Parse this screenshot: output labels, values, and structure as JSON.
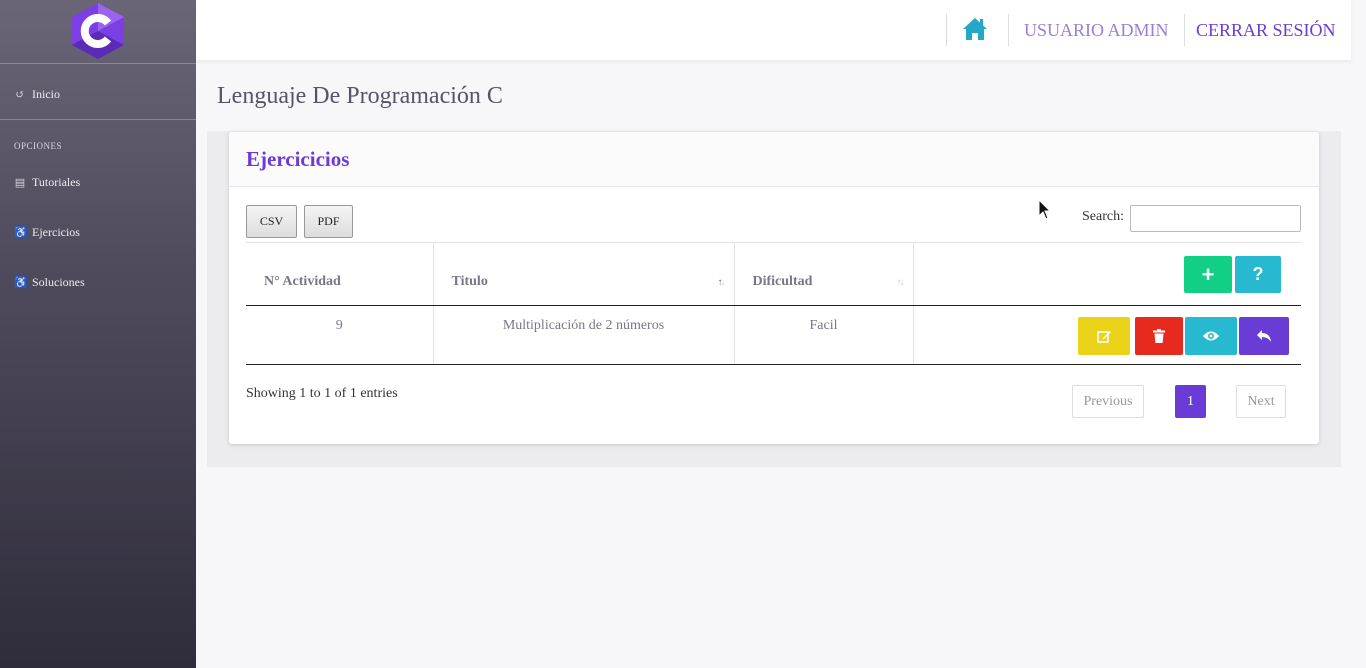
{
  "sidebar": {
    "items": [
      {
        "label": "Inicio",
        "icon": "refresh-icon"
      },
      {
        "label": "Tutoriales",
        "icon": "book-icon"
      },
      {
        "label": "Ejercicios",
        "icon": "wheelchair-icon"
      },
      {
        "label": "Soluciones",
        "icon": "wheelchair-icon"
      }
    ],
    "section_heading": "OPCIONES"
  },
  "topbar": {
    "home_icon": "home-icon",
    "user_label": "USUARIO ADMIN",
    "logout_label": "CERRAR SESIÓN"
  },
  "page": {
    "title": "Lenguaje De Programación C"
  },
  "card": {
    "title": "Ejercicicios",
    "export_buttons": {
      "csv": "CSV",
      "pdf": "PDF"
    },
    "search": {
      "label": "Search:",
      "value": ""
    },
    "table": {
      "headers": [
        "N° Actividad",
        "Titulo",
        "Dificultad",
        ""
      ],
      "rows": [
        {
          "id": "9",
          "titulo": "Multiplicación de 2 números",
          "dificultad": "Facil"
        }
      ]
    },
    "header_actions": {
      "add": "+",
      "help": "?"
    },
    "row_actions": [
      "edit-icon",
      "trash-icon",
      "eye-icon",
      "reply-icon"
    ],
    "info": "Showing 1 to 1 of 1 entries",
    "pagination": {
      "previous": "Previous",
      "current": "1",
      "next": "Next"
    }
  },
  "colors": {
    "accent": "#6a3cd6",
    "add": "#12cf86",
    "info": "#26b9d0",
    "edit": "#ead319",
    "delete": "#e62b1e"
  }
}
